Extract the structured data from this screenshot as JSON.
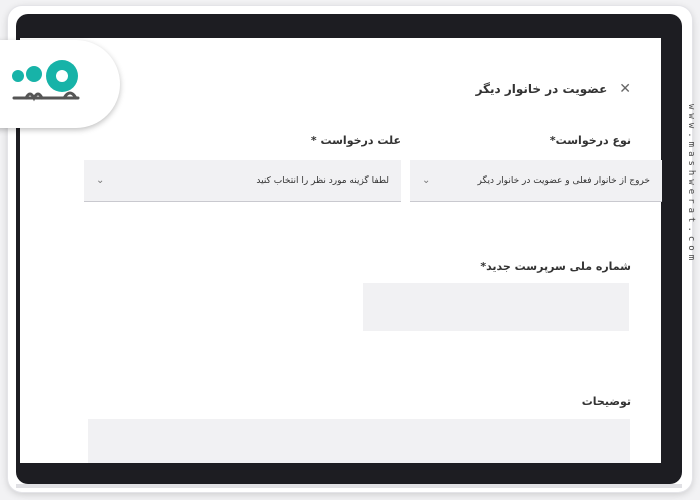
{
  "watermark": "www.mashwerat.com",
  "logo": {
    "text": "مشورت"
  },
  "dialog": {
    "title": "عضویت در خانوار دیگر",
    "close_glyph": "✕"
  },
  "form": {
    "request_type": {
      "label": "نوع درخواست*",
      "value": "خروج از خانوار فعلی و عضویت در خانوار دیگر"
    },
    "request_reason": {
      "label": "علت درخواست *",
      "placeholder": "لطفا گزینه مورد نظر را انتخاب کنید"
    },
    "new_head_national_id": {
      "label": "شماره ملی سرپرست جدید*",
      "value": ""
    },
    "description": {
      "label": "توضیحات",
      "value": ""
    }
  },
  "icons": {
    "chevron": "⌄"
  }
}
